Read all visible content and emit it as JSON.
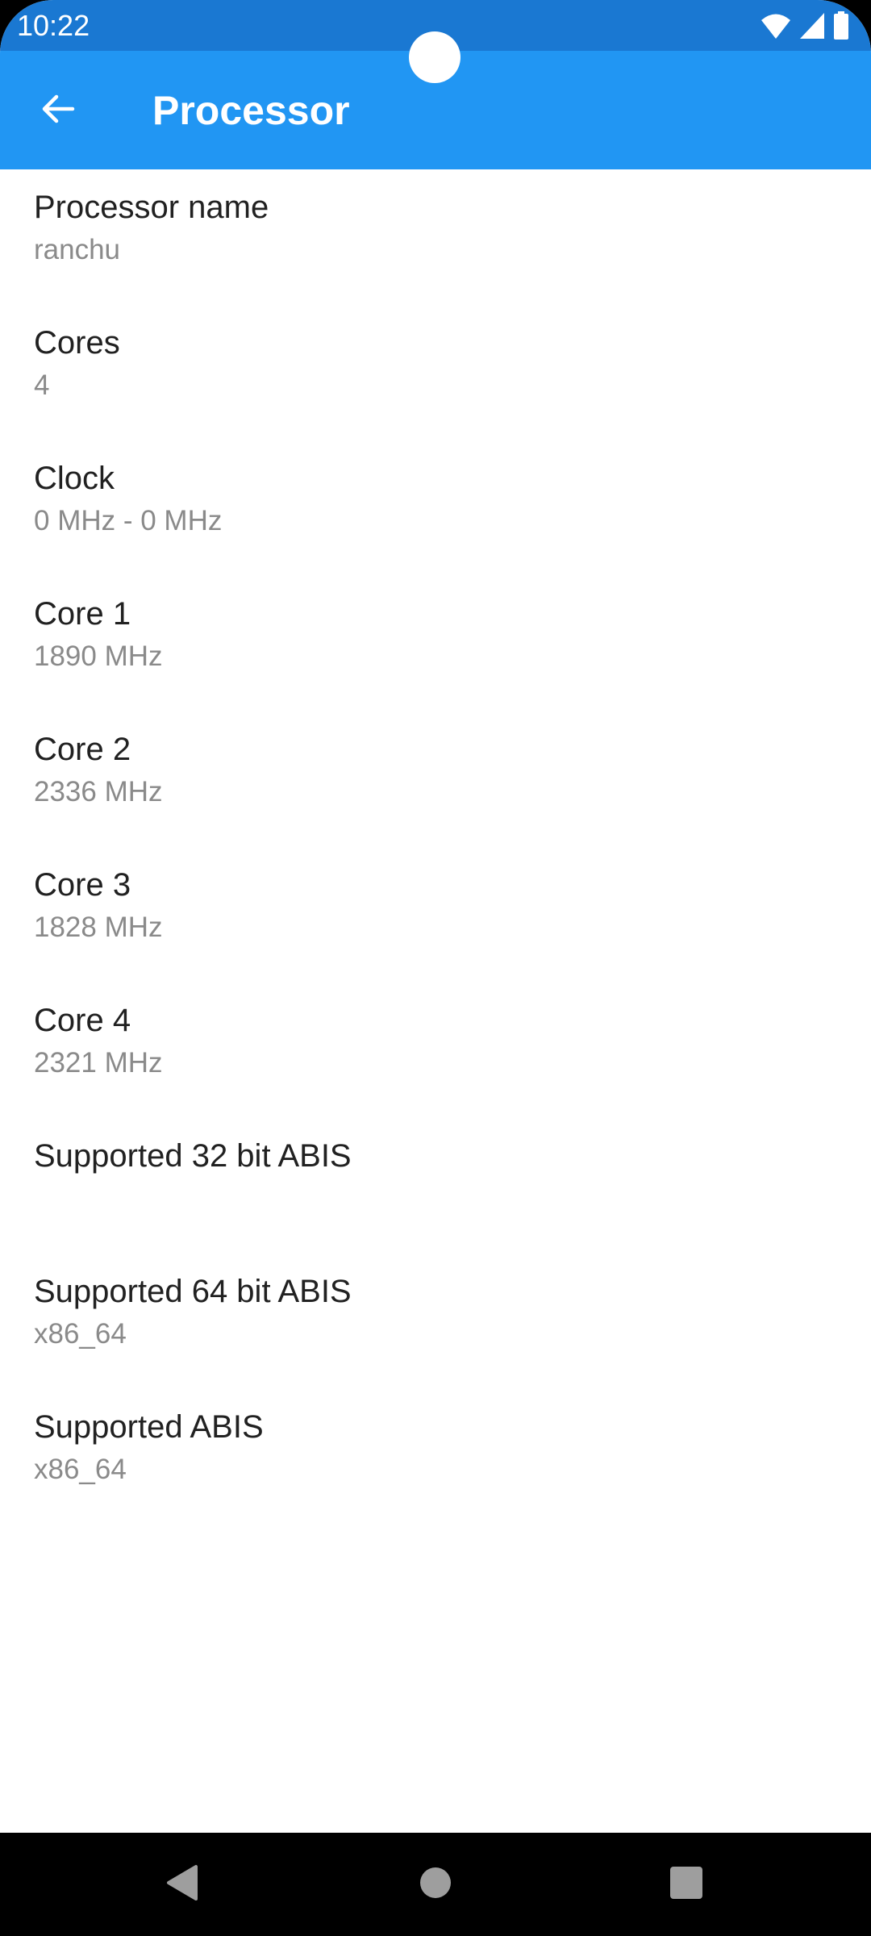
{
  "status_bar": {
    "time": "10:22",
    "icons": [
      "wifi-icon",
      "cell-signal-icon",
      "battery-icon"
    ],
    "color": "#1a78d2"
  },
  "app_bar": {
    "title": "Processor",
    "back_icon": "arrow-back-icon",
    "color": "#2196f3"
  },
  "items": [
    {
      "label": "Processor name",
      "value": "ranchu"
    },
    {
      "label": "Cores",
      "value": "4"
    },
    {
      "label": "Clock",
      "value": "0 MHz - 0 MHz"
    },
    {
      "label": "Core 1",
      "value": "1890 MHz"
    },
    {
      "label": "Core 2",
      "value": "2336 MHz"
    },
    {
      "label": "Core 3",
      "value": "1828 MHz"
    },
    {
      "label": "Core 4",
      "value": "2321 MHz"
    },
    {
      "label": "Supported 32 bit ABIS",
      "value": ""
    },
    {
      "label": "Supported 64 bit ABIS",
      "value": "x86_64"
    },
    {
      "label": "Supported ABIS",
      "value": "x86_64"
    }
  ],
  "nav_bar": {
    "buttons": [
      "back-triangle-icon",
      "home-circle-icon",
      "recents-square-icon"
    ]
  }
}
